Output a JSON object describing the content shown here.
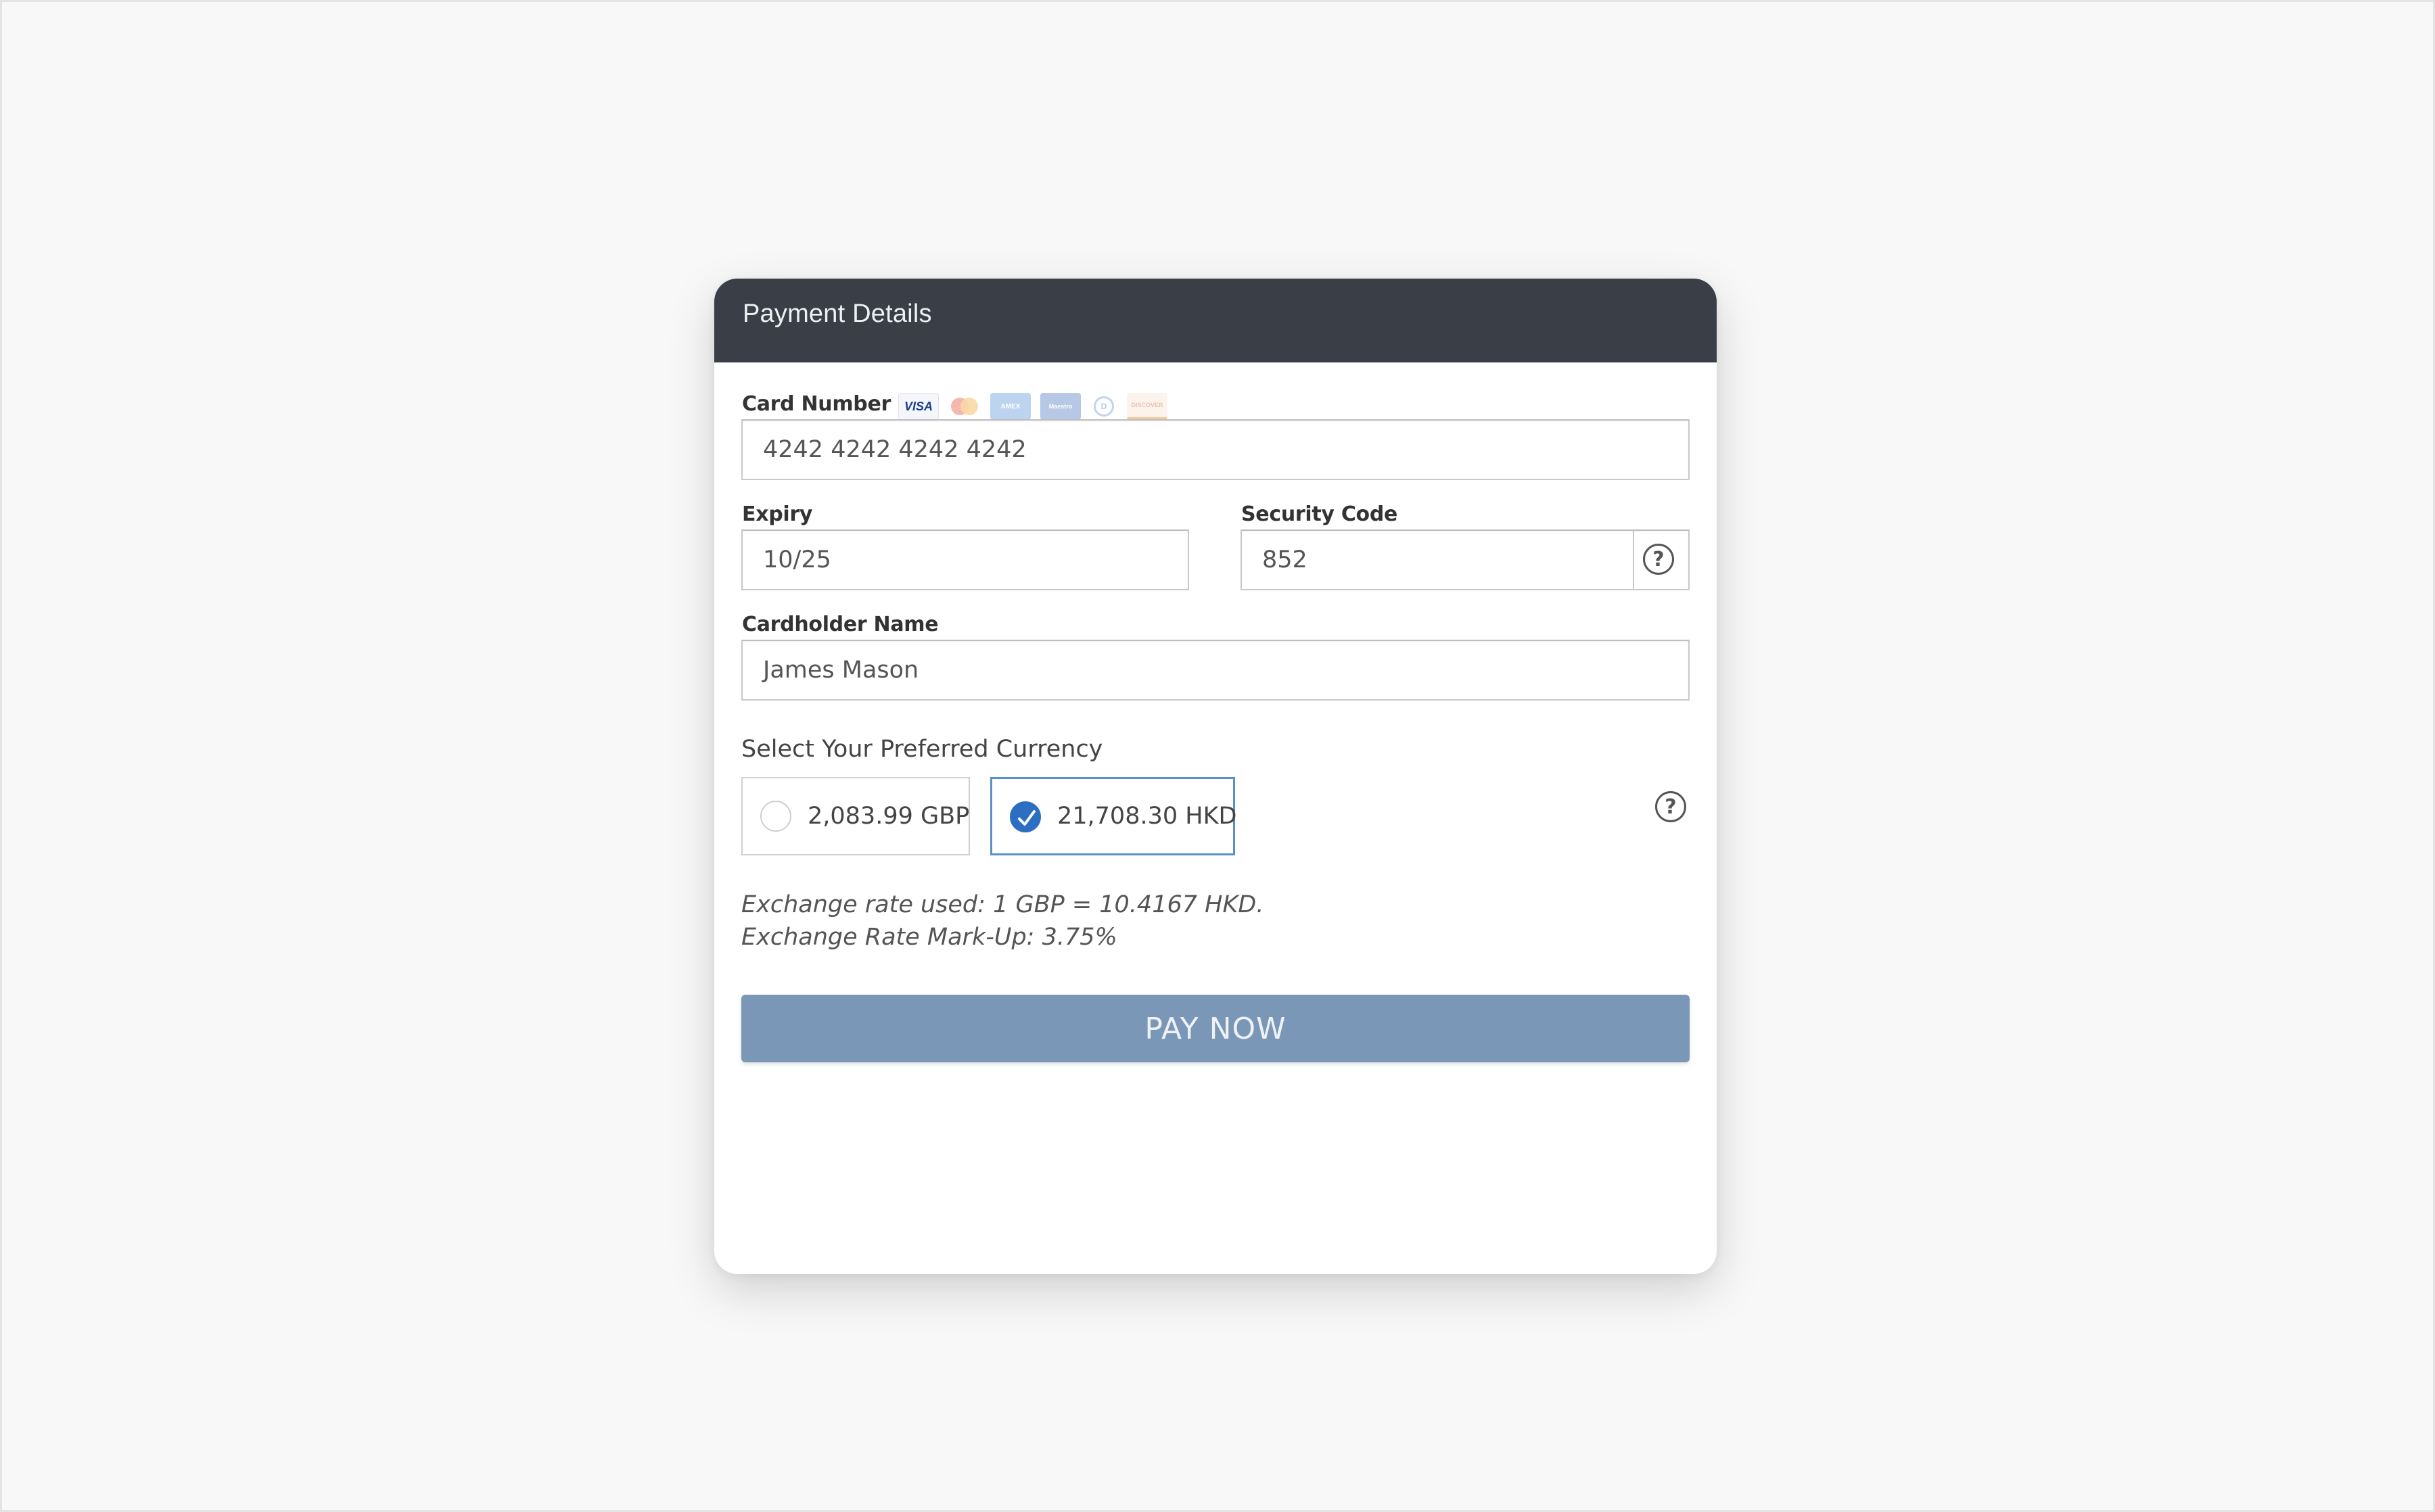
{
  "header": {
    "title": "Payment Details"
  },
  "card_number": {
    "label": "Card Number",
    "value": "4242 4242 4242 4242",
    "card_logos": [
      {
        "name": "visa-logo",
        "text": "VISA"
      },
      {
        "name": "mastercard-logo",
        "text": ""
      },
      {
        "name": "amex-logo",
        "text": "AMEX"
      },
      {
        "name": "maestro-logo",
        "text": "Maestro"
      },
      {
        "name": "diners-logo",
        "text": "D"
      },
      {
        "name": "discover-logo",
        "text": "DISCOVER"
      }
    ]
  },
  "expiry": {
    "label": "Expiry",
    "value": "10/25"
  },
  "security_code": {
    "label": "Security Code",
    "value": "852",
    "help_icon": "?"
  },
  "cardholder": {
    "label": "Cardholder Name",
    "value": "James Mason"
  },
  "currency": {
    "title": "Select Your Preferred Currency",
    "help_icon": "?",
    "options": [
      {
        "label": "2,083.99 GBP",
        "selected": false
      },
      {
        "label": "21,708.30 HKD",
        "selected": true
      }
    ],
    "exchange_rate_note": "Exchange rate used: 1 GBP = 10.4167 HKD.",
    "markup_note": "Exchange Rate Mark-Up: 3.75%"
  },
  "pay_button": {
    "label": "PAY NOW"
  },
  "colors": {
    "header_bg": "#3a3e46",
    "pay_button_bg": "#7b97b7",
    "selected_accent": "#2c6fc2",
    "selected_border": "#5b8fc7"
  }
}
